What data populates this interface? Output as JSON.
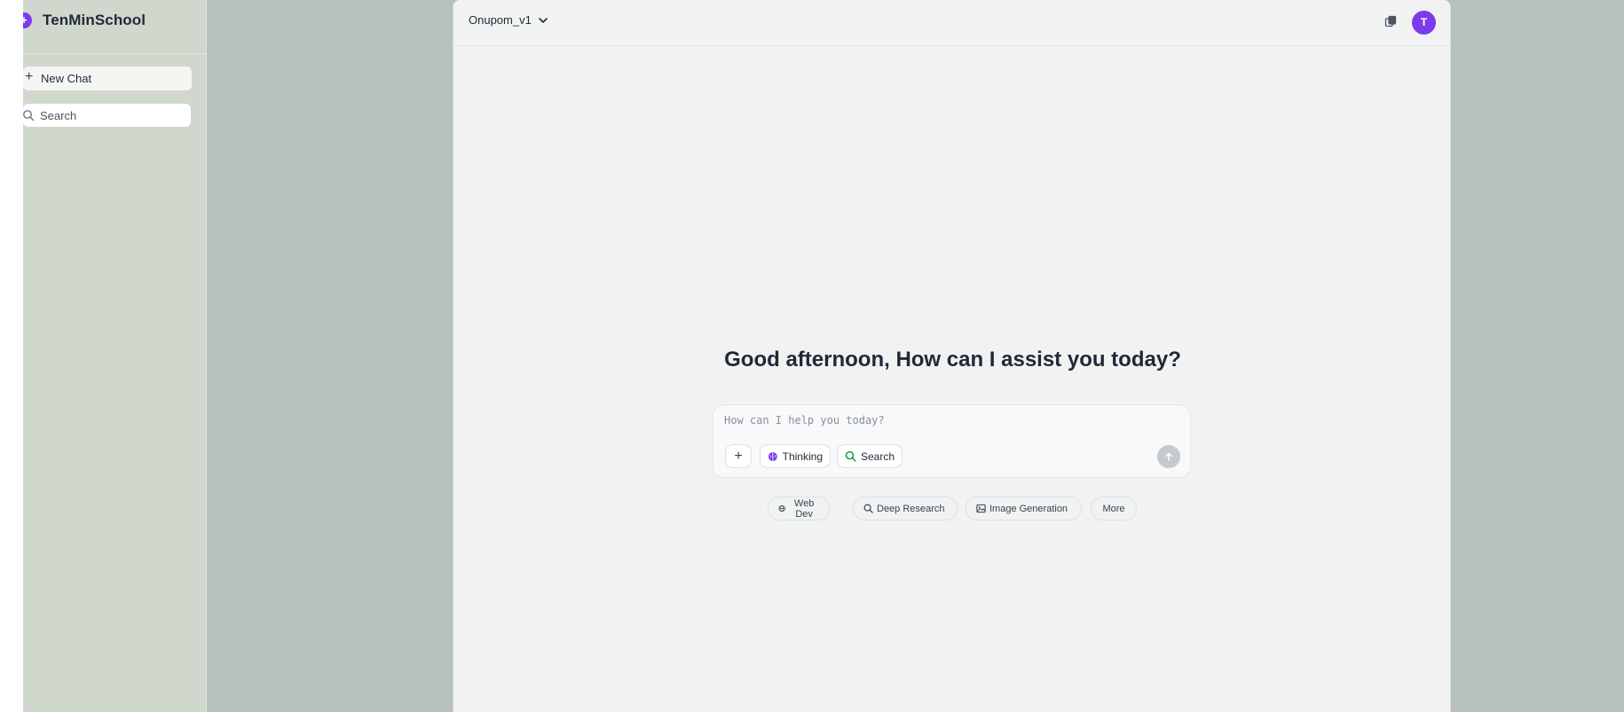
{
  "sidebar": {
    "brand": "TenMinSchool",
    "logo_glyph": "+",
    "new_chat_label": "New Chat",
    "search_placeholder": "Search"
  },
  "header": {
    "model_name": "Onupom_v1",
    "avatar_initial": "T"
  },
  "main": {
    "greeting": "Good afternoon, How can I assist you today?",
    "composer": {
      "placeholder": "How can I help you today?",
      "add_label": "+",
      "thinking_label": "Thinking",
      "search_label": "Search"
    },
    "suggestions": {
      "web_dev": "Web Dev",
      "deep_research": "Deep Research",
      "image_generation": "Image Generation",
      "more": "More"
    }
  },
  "colors": {
    "accent": "#7c3aed",
    "sidebar_bg": "#d0d7cc",
    "backdrop": "#b6c0be",
    "panel_bg": "#f1f3f2",
    "search_icon": "#16a34a"
  }
}
